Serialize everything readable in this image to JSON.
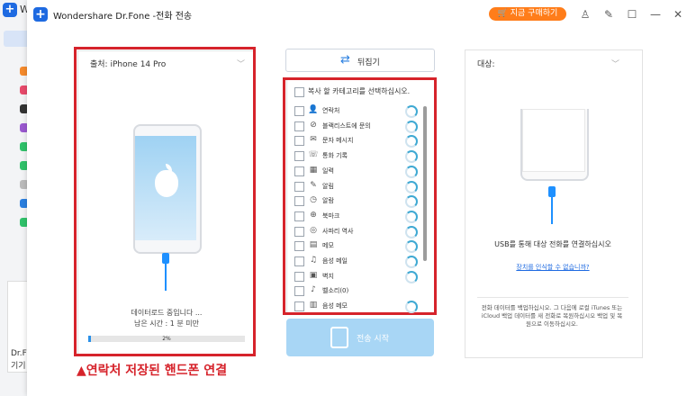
{
  "background": {
    "app_initial": "W",
    "card_line1": "Dr.Fo",
    "card_line2": "기기"
  },
  "window": {
    "title": "Wondershare Dr.Fone -전화 전송",
    "buy_button": "지금 구매하기",
    "controls": [
      "user-icon",
      "edit-icon",
      "feedback-icon",
      "minimize-icon",
      "close-icon"
    ]
  },
  "source": {
    "label": "출처: iPhone 14 Pro",
    "status_line1": "데이터로드 중입니다 ...",
    "status_line2": "남은 시간 : 1 분 미만",
    "progress": 2,
    "progress_label": "2%"
  },
  "annotation": "▲연락처 저장된 핸드폰 연결",
  "middle": {
    "flip_label": "뒤집기",
    "header": "복사 할 카테고리를 선택하십시오.",
    "categories": [
      {
        "label": "연락처",
        "icon": "👤"
      },
      {
        "label": "블랙리스트에 문의",
        "icon": "⊘"
      },
      {
        "label": "문자 메시지",
        "icon": "✉"
      },
      {
        "label": "통화 기록",
        "icon": "☏"
      },
      {
        "label": "일력",
        "icon": "▦"
      },
      {
        "label": "알림",
        "icon": "✎"
      },
      {
        "label": "알람",
        "icon": "◷"
      },
      {
        "label": "북마크",
        "icon": "⊕"
      },
      {
        "label": "사파리 역사",
        "icon": "◎"
      },
      {
        "label": "메모",
        "icon": "▤"
      },
      {
        "label": "음성 메일",
        "icon": "♫"
      },
      {
        "label": "벽지",
        "icon": "▣"
      },
      {
        "label": "벨소리(0)",
        "icon": "♪"
      },
      {
        "label": "음성 메모",
        "icon": "▥"
      }
    ],
    "start_label": "전송 시작"
  },
  "destination": {
    "label": "대상:",
    "instruction": "USB를 통해 대상 전화를 연결하십시오",
    "link": "장치를 인식할 수 없습니까?",
    "note": "전화 데이터를 백업하십시오. 그 다음에 로컬 iTunes 또는 iCloud 백업 데이터를 새 전화로 복원하십시오 백업 및 복원으로 이동하십시오."
  },
  "colors": {
    "accent": "#1e6ae1",
    "buy": "#ff7d1a",
    "annotation": "#d6232b",
    "start_disabled": "#a8d6f5"
  }
}
